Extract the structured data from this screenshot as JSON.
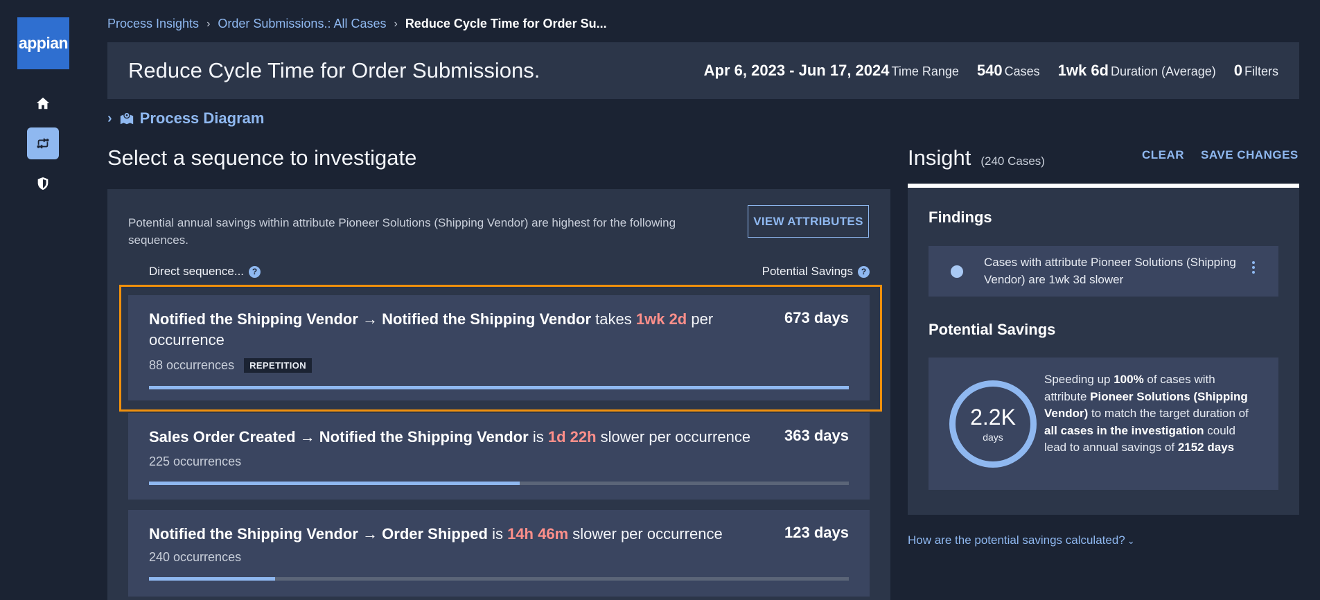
{
  "logo": {
    "text": "appian"
  },
  "nav": {
    "items": [
      "home-icon",
      "process-icon",
      "shield-icon"
    ],
    "active": "process-icon"
  },
  "breadcrumb": {
    "items": [
      "Process Insights",
      "Order Submissions.: All Cases"
    ],
    "current": "Reduce Cycle Time for Order Su..."
  },
  "header": {
    "title": "Reduce Cycle Time for Order Submissions.",
    "date_range": "Apr 6, 2023 - Jun 17, 2024",
    "date_range_label": "Time Range",
    "cases": "540",
    "cases_label": "Cases",
    "duration": "1wk 6d",
    "duration_label": "Duration (Average)",
    "filters": "0",
    "filters_label": "Filters"
  },
  "process_diagram": {
    "label": "Process Diagram"
  },
  "sequence_section": {
    "title": "Select a sequence to investigate",
    "intro": "Potential annual savings within attribute Pioneer Solutions (Shipping Vendor) are highest for the following sequences.",
    "view_attributes_label": "VIEW ATTRIBUTES",
    "col_sequence": "Direct sequence...",
    "col_savings": "Potential Savings",
    "sequences": [
      {
        "from": "Notified the Shipping Vendor",
        "arrow": "→",
        "to": "Notified the Shipping Vendor",
        "verb": "takes",
        "time": "1wk 2d",
        "suffix": "per occurrence",
        "savings": "673 days",
        "occurrences": "88 occurrences",
        "tag": "REPETITION",
        "progress": 1.0
      },
      {
        "from": "Sales Order Created",
        "arrow": "→",
        "to": "Notified the Shipping Vendor",
        "verb": "is",
        "time": "1d 22h",
        "suffix": "slower per occurrence",
        "savings": "363 days",
        "occurrences": "225 occurrences",
        "progress": 0.53
      },
      {
        "from": "Notified the Shipping Vendor",
        "arrow": "→",
        "to": "Order Shipped",
        "verb": "is",
        "time": "14h 46m",
        "suffix": "slower per occurrence",
        "savings": "123 days",
        "occurrences": "240 occurrences",
        "progress": 0.18
      }
    ]
  },
  "insight": {
    "title": "Insight",
    "count": "(240 Cases)",
    "clear_label": "CLEAR",
    "save_label": "SAVE CHANGES",
    "findings_title": "Findings",
    "finding_text": "Cases with attribute Pioneer Solutions (Shipping Vendor) are 1wk 3d slower",
    "savings_title": "Potential Savings",
    "ring_value": "2.2K",
    "ring_unit": "days",
    "savings_parts": {
      "p1": "Speeding up ",
      "b1": "100%",
      "p2": " of cases with attribute ",
      "b2": "Pioneer Solutions (Shipping Vendor)",
      "p3": " to match the target duration of ",
      "b3": "all cases in the investigation",
      "p4": " could lead to annual savings of ",
      "b4": "2152 days"
    },
    "calc_link": "How are the potential savings calculated?"
  },
  "colors": {
    "accent": "#8fb8f0",
    "highlight": "#ff8f8a",
    "selection_border": "#f0900c"
  }
}
